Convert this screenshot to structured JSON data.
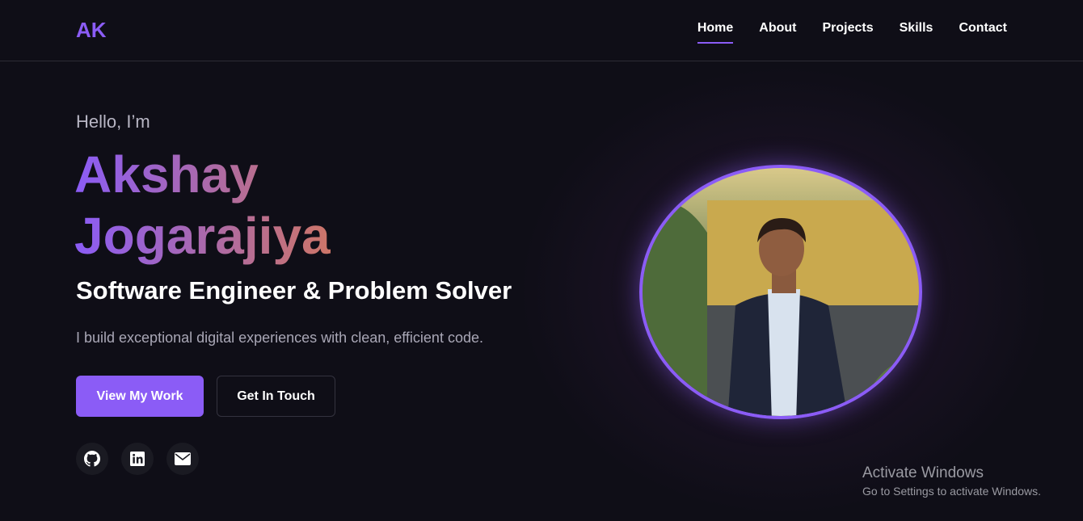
{
  "nav": {
    "logo": "AK",
    "links": [
      {
        "label": "Home",
        "active": true
      },
      {
        "label": "About"
      },
      {
        "label": "Projects"
      },
      {
        "label": "Skills"
      },
      {
        "label": "Contact"
      }
    ]
  },
  "hero": {
    "greeting": "Hello, I’m",
    "name": "Akshay Jogarajiya",
    "role": "Software Engineer & Problem Solver",
    "description": "I build exceptional digital experiences with clean, efficient code.",
    "primary_button": "View My Work",
    "secondary_button": "Get In Touch",
    "socials": [
      "github-icon",
      "linkedin-icon",
      "email-icon"
    ]
  },
  "colors": {
    "accent": "#8b5cf6",
    "background": "#0f0e17"
  },
  "watermark": {
    "title": "Activate Windows",
    "subtitle": "Go to Settings to activate Windows."
  }
}
